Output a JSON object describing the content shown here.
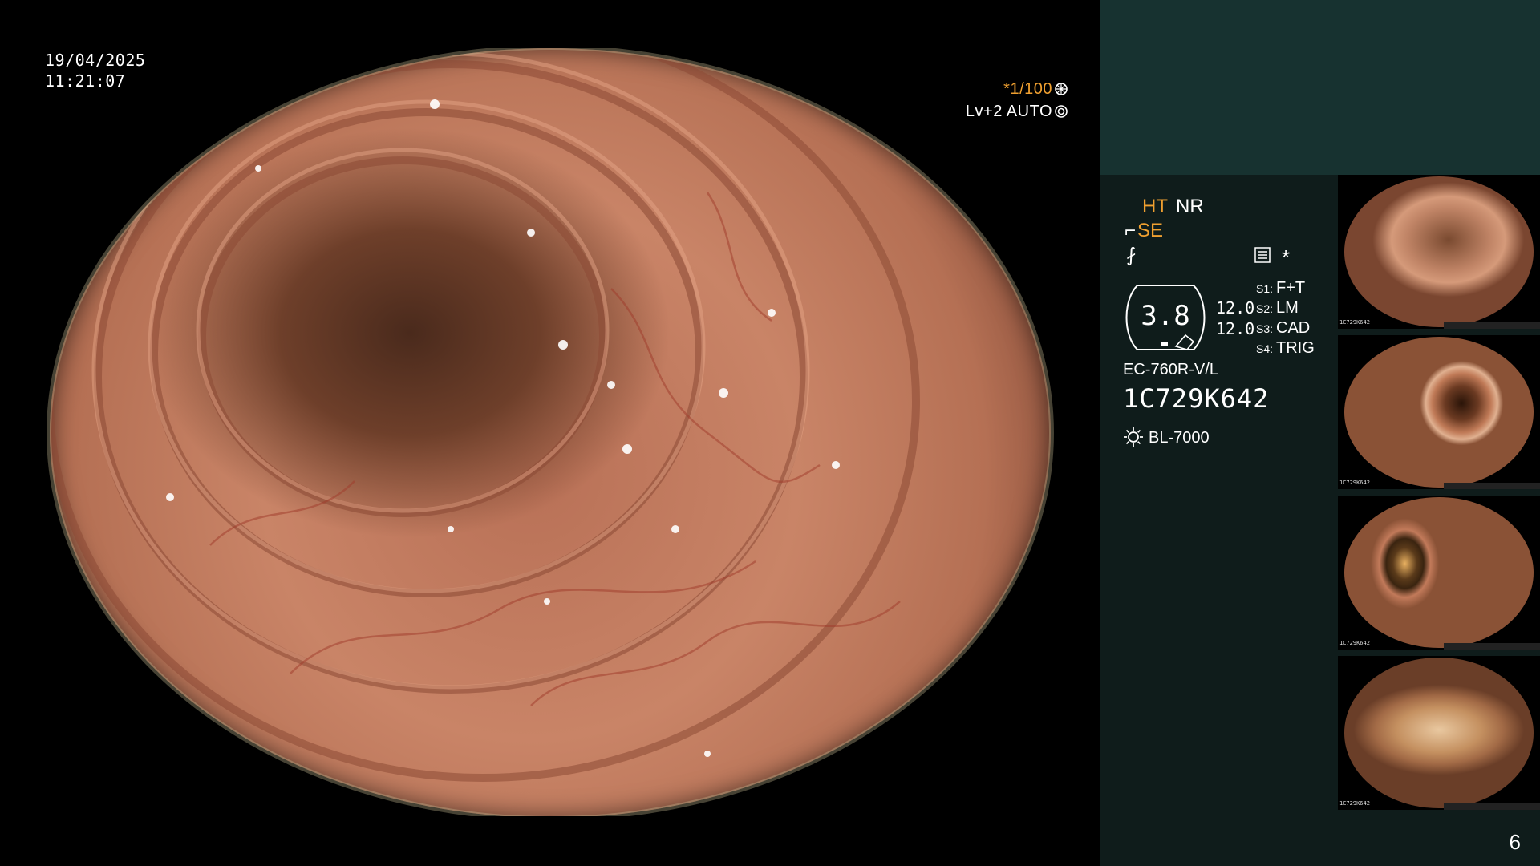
{
  "overlay": {
    "date": "19/04/2025",
    "time": "11:21:07",
    "shutter": "*1/100",
    "level": "Lv+2 AUTO"
  },
  "panel": {
    "mode1": "HT",
    "mode2": "NR",
    "mode3": "SE",
    "f_symbol": "⨏",
    "star": "*",
    "gauge_value": "3.8",
    "gauge_right_1": "12.0",
    "gauge_right_2": "12.0",
    "switches": [
      {
        "key": "S1:",
        "value": "F+T"
      },
      {
        "key": "S2:",
        "value": "LM"
      },
      {
        "key": "S3:",
        "value": "CAD"
      },
      {
        "key": "S4:",
        "value": "TRIG"
      }
    ],
    "scope_model": "EC-760R-V/L",
    "scope_serial": "1C729K642",
    "light_source": "BL-7000",
    "page_number": "6"
  },
  "thumbnails": [
    {
      "caption": "1C729K642"
    },
    {
      "caption": "1C729K642"
    },
    {
      "caption": "1C729K642"
    },
    {
      "caption": "1C729K642"
    }
  ],
  "colors": {
    "accent_orange": "#f0a030",
    "panel_bg": "#0f1c1b",
    "panel_top_bg": "#173230"
  }
}
